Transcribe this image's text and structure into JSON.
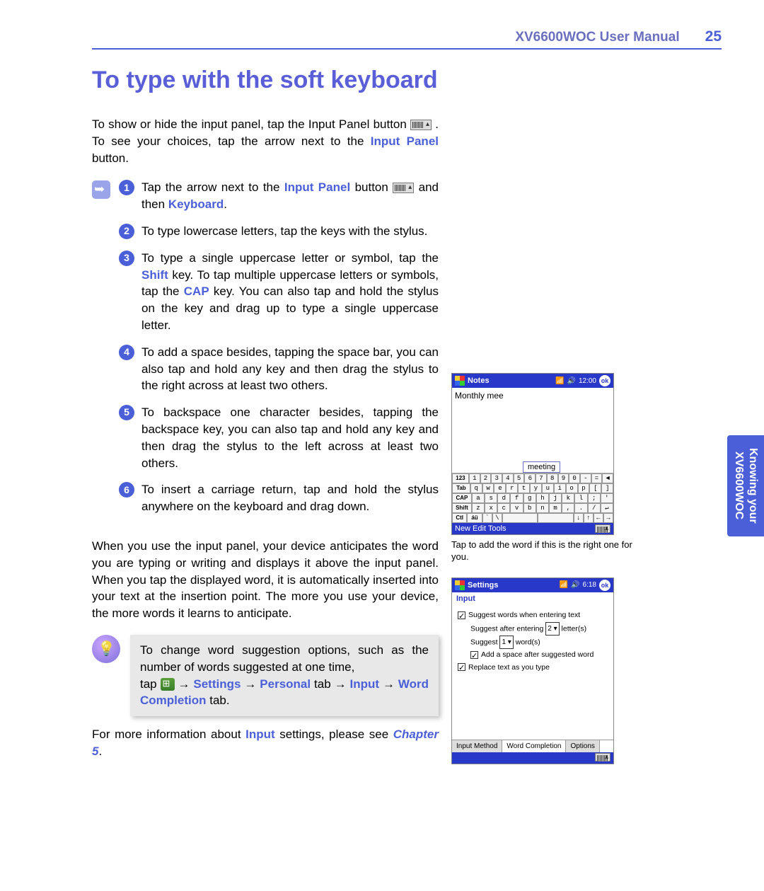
{
  "header": {
    "manual_title": "XV6600WOC User Manual",
    "page_number": "25"
  },
  "section_title": "To type with the soft keyboard",
  "intro": {
    "p1a": "To show or hide the input panel, tap the Input Panel button ",
    "p1b": " . To see your choices, tap the arrow next to the ",
    "input_panel": "Input Panel",
    "p1c": " button."
  },
  "steps": [
    {
      "n": "1",
      "pre": "Tap the arrow next to the ",
      "em1": "Input Panel",
      "mid": " button ",
      "post": " and then ",
      "em2": "Keyboard",
      "tail": "."
    },
    {
      "n": "2",
      "text": "To type lowercase letters, tap the keys with the stylus."
    },
    {
      "n": "3",
      "pre": "To type a single uppercase letter or symbol, tap the ",
      "em1": "Shift",
      "mid": " key. To tap multiple uppercase letters or symbols, tap the ",
      "em2": "CAP",
      "post": " key.  You can also tap and hold the stylus on the key and drag up to type a single uppercase letter."
    },
    {
      "n": "4",
      "text": "To add a space besides, tapping the space bar, you can also tap and hold any key and then drag the stylus to the right across at least two others."
    },
    {
      "n": "5",
      "text": "To backspace one character besides, tapping the backspace key, you can also tap and hold any key and then drag the stylus to the left across at least two others."
    },
    {
      "n": "6",
      "text": "To insert a carriage return, tap and hold the stylus anywhere on the keyboard and drag down."
    }
  ],
  "para2": "When you use the input panel, your device anticipates the word you are typing or writing and displays it above the input panel. When you tap the displayed word, it is automatically inserted into your text at the insertion point. The more you use your device, the more words it learns to anticipate.",
  "tip": {
    "line1": "To change word suggestion options, such as the number of  words suggested at one time,",
    "line2a": "tap ",
    "arrow": " → ",
    "settings": "Settings",
    "personal": "Personal",
    "tab_word": " tab",
    "input": "Input",
    "word_completion": "Word Completion",
    "tab_word2": " tab."
  },
  "footer": {
    "pre": "For more information about ",
    "input": "Input",
    "mid": " settings, please see ",
    "chapter": "Chapter 5",
    "post": "."
  },
  "side_tab": {
    "line1": "Knowing your",
    "line2": "XV6600WOC"
  },
  "shot1": {
    "app": "Notes",
    "time": "12:00",
    "ok": "ok",
    "body_text": "Monthly mee",
    "suggestion": "meeting",
    "rows": {
      "r1": [
        "123",
        "1",
        "2",
        "3",
        "4",
        "5",
        "6",
        "7",
        "8",
        "9",
        "0",
        "-",
        "=",
        "◄"
      ],
      "r2": [
        "Tab",
        "q",
        "w",
        "e",
        "r",
        "t",
        "y",
        "u",
        "i",
        "o",
        "p",
        "[",
        "]"
      ],
      "r3": [
        "CAP",
        "a",
        "s",
        "d",
        "f",
        "g",
        "h",
        "j",
        "k",
        "l",
        ";",
        "'"
      ],
      "r4": [
        "Shift",
        "z",
        "x",
        "c",
        "v",
        "b",
        "n",
        "m",
        ",",
        ".",
        "/",
        "↵"
      ],
      "r5": [
        "Ctl",
        "áü",
        "`",
        "\\",
        " ",
        " ",
        "↓",
        "↑",
        "←",
        "→"
      ]
    },
    "bottom": "New Edit Tools",
    "caption": "Tap to add the word if this is the right one for you."
  },
  "shot2": {
    "app": "Settings",
    "time": "6:18",
    "ok": "ok",
    "sub": "Input",
    "opt1": "Suggest words when entering text",
    "opt2a": "Suggest after entering",
    "opt2_val": "2",
    "opt2b": "letter(s)",
    "opt3a": "Suggest",
    "opt3_val": "1",
    "opt3b": "word(s)",
    "opt4": "Add a space after suggested word",
    "opt5": "Replace text as you type",
    "tabs": [
      "Input Method",
      "Word Completion",
      "Options"
    ]
  }
}
